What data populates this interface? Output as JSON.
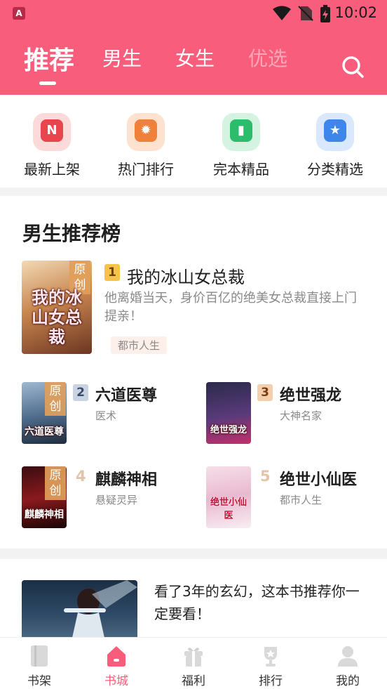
{
  "status_bar": {
    "app_badge": "A",
    "time": "10:02"
  },
  "header": {
    "tabs": [
      {
        "label": "推荐"
      },
      {
        "label": "男生"
      },
      {
        "label": "女生"
      },
      {
        "label": "优选"
      }
    ],
    "active_tab": "推荐"
  },
  "quick_entries": [
    {
      "label": "最新上架",
      "icon": "new-shelf-icon",
      "glyph": "N",
      "color": "#e8454f",
      "bg": "#fcdada"
    },
    {
      "label": "热门排行",
      "icon": "hot-rank-icon",
      "glyph": "✹",
      "color": "#f0813a",
      "bg": "#fde3cf"
    },
    {
      "label": "完本精品",
      "icon": "finished-book-icon",
      "glyph": "▮",
      "color": "#2dbb6c",
      "bg": "#d5f3e1"
    },
    {
      "label": "分类精选",
      "icon": "category-star-icon",
      "glyph": "★",
      "color": "#3f86ea",
      "bg": "#d9e8fc"
    }
  ],
  "ranking": {
    "title": "男生推荐榜",
    "top": {
      "rank": "1",
      "name": "我的冰山女总裁",
      "desc": "他离婚当天，身价百亿的绝美女总裁直接上门提亲！",
      "category": "都市人生",
      "cover_tag": "原创",
      "cover_title": "我的冰山女总裁"
    },
    "items": [
      {
        "rank": "2",
        "name": "六道医尊",
        "category": "医术",
        "cover_tag": "原创",
        "cover_title": "六道医尊"
      },
      {
        "rank": "3",
        "name": "绝世强龙",
        "category": "大神名家",
        "cover_tag": "",
        "cover_title": "绝世强龙"
      },
      {
        "rank": "4",
        "name": "麒麟神相",
        "category": "悬疑灵异",
        "cover_tag": "原创",
        "cover_title": "麒麟神相"
      },
      {
        "rank": "5",
        "name": "绝世小仙医",
        "category": "都市人生",
        "cover_tag": "",
        "cover_title": "绝世小仙医"
      }
    ]
  },
  "recommend": {
    "text": "看了3年的玄幻，这本书推荐你一定要看！"
  },
  "bottom_nav": [
    {
      "label": "书架",
      "icon": "bookshelf-icon"
    },
    {
      "label": "书城",
      "icon": "bookstore-home-icon"
    },
    {
      "label": "福利",
      "icon": "gift-icon"
    },
    {
      "label": "排行",
      "icon": "trophy-icon"
    },
    {
      "label": "我的",
      "icon": "profile-icon"
    }
  ],
  "active_nav": "书城",
  "colors": {
    "brand": "#f95d7c",
    "rank_gold": "#f5c24a",
    "rank_silver": "#c9d3e3",
    "rank_bronze": "#f3cfae"
  }
}
